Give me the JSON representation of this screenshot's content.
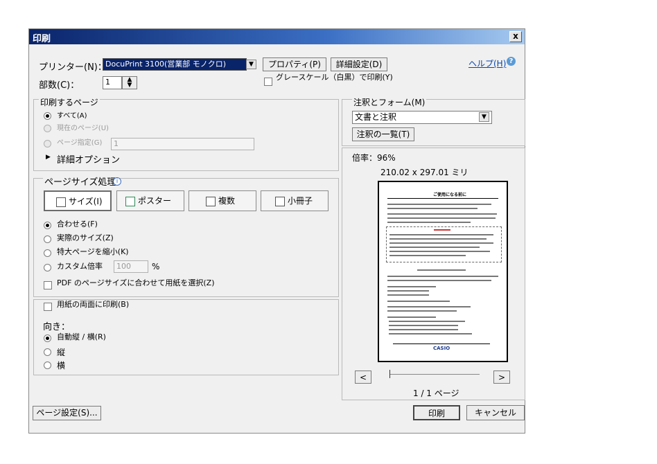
{
  "window": {
    "title": "印刷",
    "close_label": "x"
  },
  "printer": {
    "label": "プリンター(N)：",
    "selected": "DocuPrint 3100(営業部 モノクロ)",
    "properties_button": "プロパティ(P)",
    "advanced_button": "詳細設定(D)",
    "help_link": "ヘルプ(H)",
    "copies_label": "部数(C)：",
    "copies_value": "1",
    "grayscale_label": "グレースケール（白黒）で印刷(Y)"
  },
  "pages_to_print": {
    "heading": "印刷するページ",
    "options": [
      "すべて(A)",
      "現在のページ(U)",
      "ページ指定(G)"
    ],
    "range_value": "1",
    "more_options": "詳細オプション"
  },
  "page_sizing": {
    "heading": "ページサイズ処理",
    "tabs": [
      "サイズ(I)",
      "ポスター",
      "複数",
      "小冊子"
    ],
    "options": [
      "合わせる(F)",
      "実際のサイズ(Z)",
      "特大ページを縮小(K)",
      "カスタム倍率"
    ],
    "custom_scale_value": "100",
    "percent": "%",
    "paper_source_label": "PDF のページサイズに合わせて用紙を選択(Z)"
  },
  "orientation": {
    "duplex_label": "用紙の両面に印刷(B)",
    "heading": "向き：",
    "options": [
      "自動縦 / 横(R)",
      "縦",
      "横"
    ]
  },
  "comments": {
    "heading": "注釈とフォーム(M)",
    "selected": "文書と注釈",
    "summary_button": "注釈の一覧(T)"
  },
  "preview": {
    "scale": "倍率：96%",
    "dimensions": "210.02 x 297.01 ミリ",
    "page_indicator": "1 / 1 ページ",
    "prev_button": "<",
    "next_button": ">",
    "doc_title": "ご使用になる前に",
    "doc_logo": "CASIO",
    "slider_position": 0
  },
  "footer": {
    "page_setup_button": "ページ設定(S)...",
    "print_button": "印刷",
    "cancel_button": "キャンセル"
  }
}
